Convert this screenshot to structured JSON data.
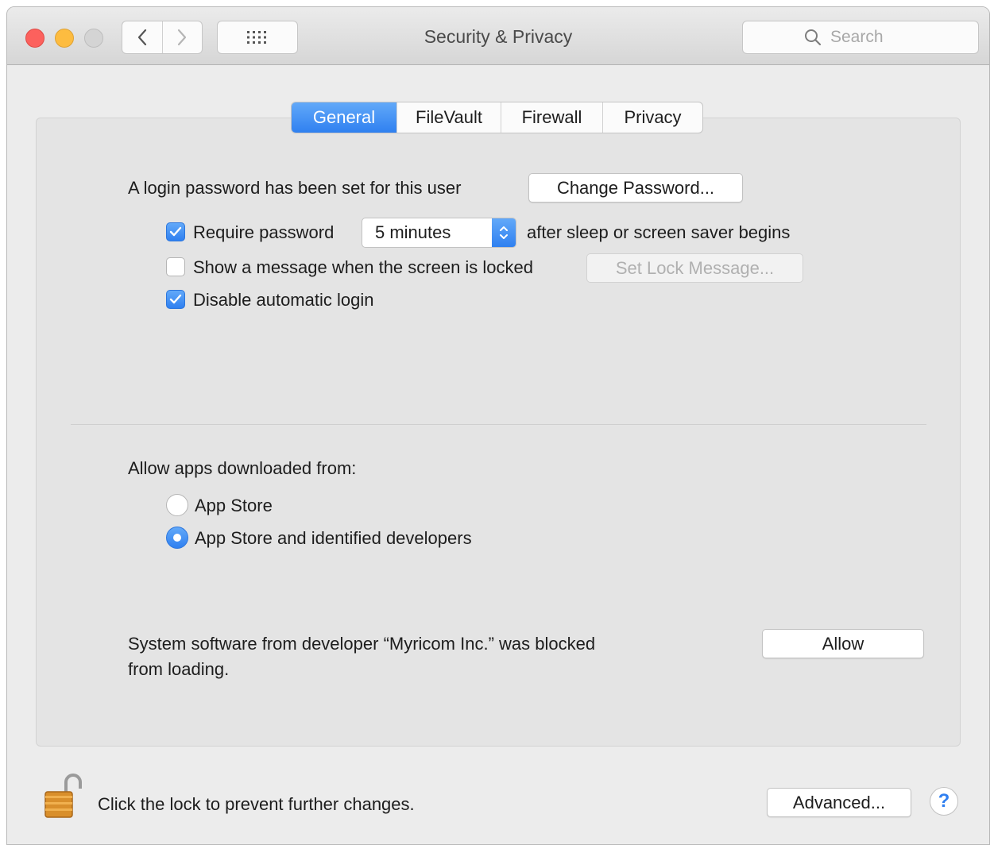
{
  "window": {
    "title": "Security & Privacy",
    "search_placeholder": "Search"
  },
  "tabs": [
    {
      "label": "General",
      "active": true
    },
    {
      "label": "FileVault",
      "active": false
    },
    {
      "label": "Firewall",
      "active": false
    },
    {
      "label": "Privacy",
      "active": false
    }
  ],
  "general": {
    "login_text": "A login password has been set for this user",
    "change_password_label": "Change Password...",
    "require_password": {
      "label": "Require password",
      "checked": true
    },
    "delay_select": {
      "value": "5 minutes"
    },
    "after_sleep_text": "after sleep or screen saver begins",
    "show_message": {
      "label": "Show a message when the screen is locked",
      "checked": false
    },
    "set_lock_message_label": "Set Lock Message...",
    "disable_auto_login": {
      "label": "Disable automatic login",
      "checked": true
    }
  },
  "apps": {
    "heading": "Allow apps downloaded from:",
    "options": [
      {
        "label": "App Store",
        "selected": false
      },
      {
        "label": "App Store and identified developers",
        "selected": true
      }
    ]
  },
  "blocked": {
    "line1": "System software from developer “Myricom Inc.” was blocked",
    "line2": "from loading.",
    "allow_label": "Allow"
  },
  "footer": {
    "lock_text": "Click the lock to prevent further changes.",
    "advanced_label": "Advanced...",
    "help_label": "?"
  },
  "colors": {
    "accent": "#2f80f0",
    "close": "#fc615d",
    "minimize": "#fdbc40",
    "zoom_inactive": "#d4d4d4"
  },
  "icons": {
    "back": "chevron-left-icon",
    "forward": "chevron-right-icon",
    "show_all": "grid-icon",
    "search": "search-icon",
    "lock": "unlocked-padlock-icon"
  }
}
